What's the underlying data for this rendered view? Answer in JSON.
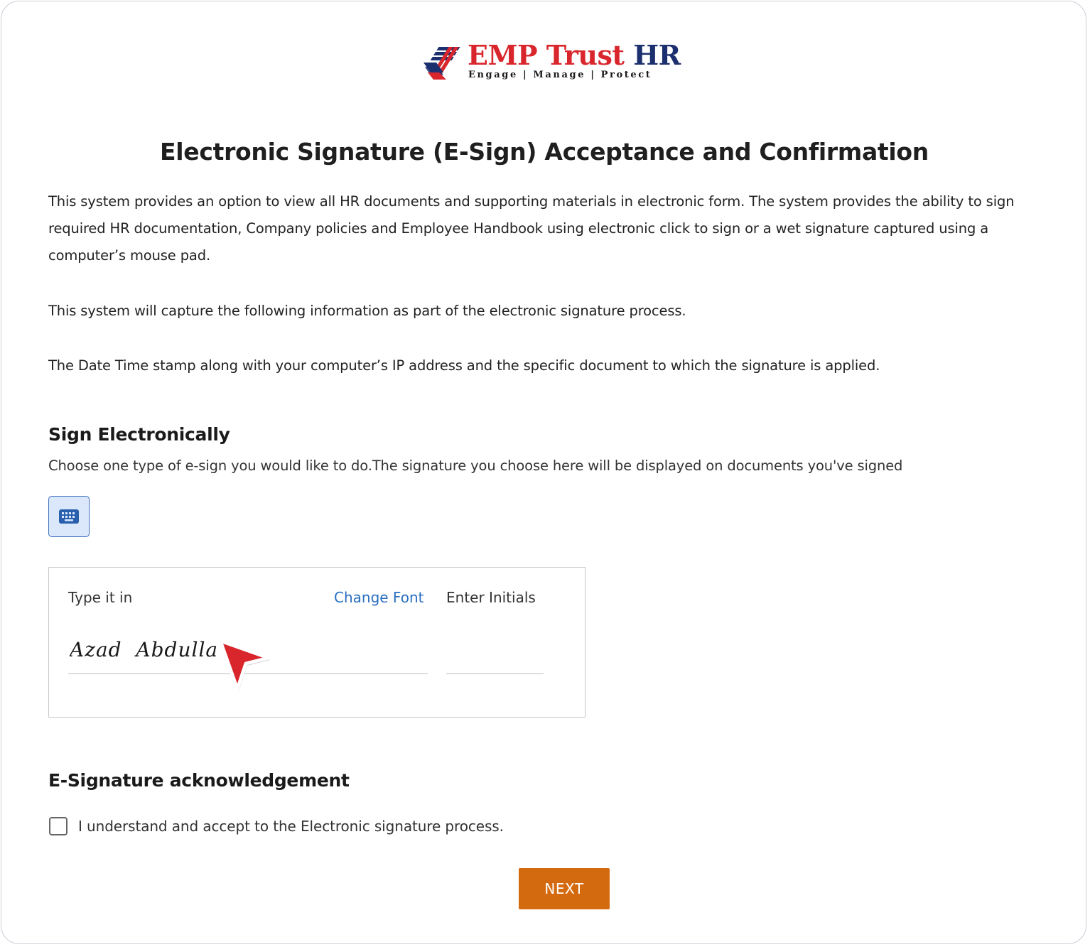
{
  "brand": {
    "name_part1": "EMP Trust",
    "name_part2": "HR",
    "tagline": "Engage | Manage | Protect",
    "colors": {
      "red": "#d9262c",
      "blue": "#1c2f6e"
    }
  },
  "page": {
    "title": "Electronic Signature (E-Sign) Acceptance and Confirmation",
    "paragraphs": [
      "This system provides an option to view all HR documents and supporting materials in electronic form. The system provides the ability to sign required HR documentation, Company policies and Employee Handbook using electronic click to sign or a wet signature captured using a computer’s mouse pad.",
      "This system will capture the following information as part of the electronic signature process.",
      "The Date Time stamp along with your computer’s IP address and the specific document to which the signature is applied."
    ]
  },
  "sign": {
    "heading": "Sign Electronically",
    "subtitle": "Choose one type of e-sign you would like to do.The signature you choose here will be displayed on documents you've signed",
    "type_icon": "keyboard-icon",
    "type_label": "Type it in",
    "change_font_label": "Change Font",
    "initials_label": "Enter Initials",
    "signature_value": "Azad  Abdulla",
    "initials_value": ""
  },
  "acknowledgement": {
    "heading": "E-Signature acknowledgement",
    "checkbox_label": "I understand and accept to the Electronic signature process.",
    "checked": false
  },
  "actions": {
    "next_label": "NEXT",
    "next_color": "#d46a10"
  }
}
